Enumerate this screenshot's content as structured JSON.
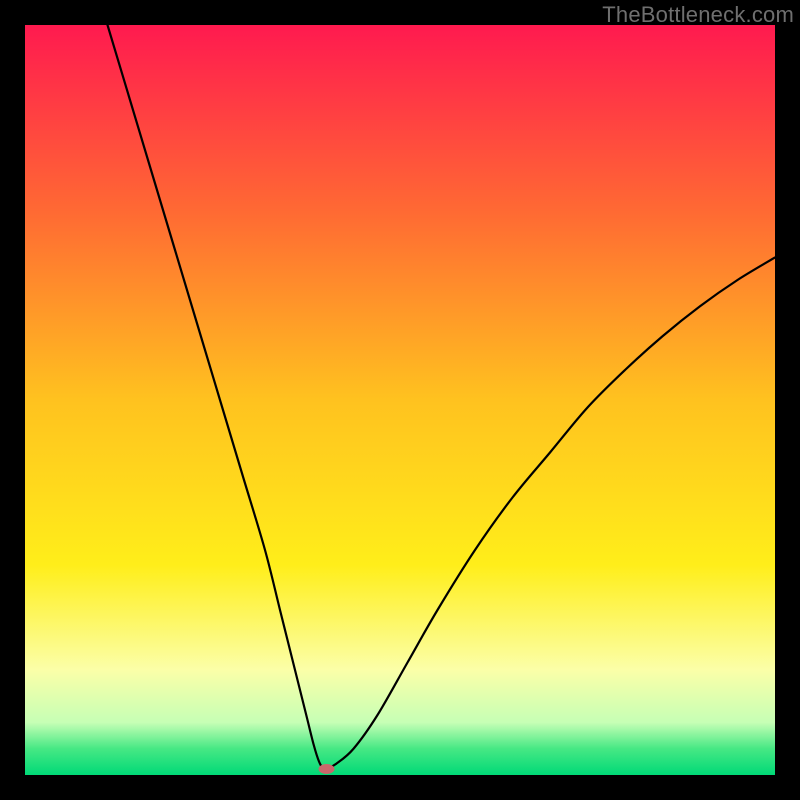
{
  "watermark": "TheBottleneck.com",
  "chart_data": {
    "type": "line",
    "title": "",
    "xlabel": "",
    "ylabel": "",
    "xlim": [
      0,
      100
    ],
    "ylim": [
      0,
      100
    ],
    "grid": false,
    "legend": false,
    "background_gradient_stops": [
      {
        "offset": 0.0,
        "color": "#ff1a4f"
      },
      {
        "offset": 0.25,
        "color": "#ff6a33"
      },
      {
        "offset": 0.5,
        "color": "#ffc21f"
      },
      {
        "offset": 0.72,
        "color": "#ffee1a"
      },
      {
        "offset": 0.86,
        "color": "#fbffa8"
      },
      {
        "offset": 0.93,
        "color": "#c6ffb5"
      },
      {
        "offset": 0.965,
        "color": "#46e884"
      },
      {
        "offset": 1.0,
        "color": "#00d977"
      }
    ],
    "series": [
      {
        "name": "bottleneck-curve",
        "x": [
          11,
          14,
          17,
          20,
          23,
          26,
          29,
          32,
          34,
          36,
          37.5,
          38.5,
          39.2,
          39.8,
          40.2,
          41.5,
          43.8,
          47,
          51,
          55,
          60,
          65,
          70,
          75,
          80,
          85,
          90,
          95,
          100
        ],
        "values": [
          100,
          90,
          80,
          70,
          60,
          50,
          40,
          30,
          22,
          14,
          8,
          4,
          1.8,
          0.8,
          0.8,
          1.5,
          3.5,
          8,
          15,
          22,
          30,
          37,
          43,
          49,
          54,
          58.5,
          62.5,
          66,
          69
        ]
      }
    ],
    "marker": {
      "name": "optimum-point",
      "x": 40.2,
      "y": 0.8,
      "color": "#c9676b",
      "rx": 8,
      "ry": 5
    }
  }
}
